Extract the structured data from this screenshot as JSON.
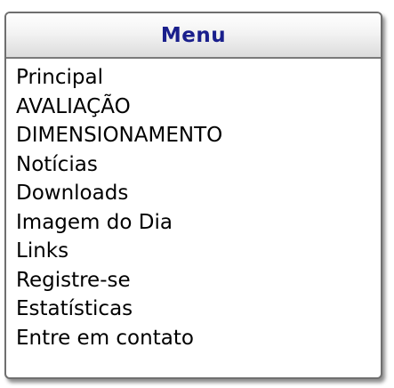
{
  "menu": {
    "title": "Menu",
    "items": [
      {
        "label": "Principal"
      },
      {
        "label": "AVALIAÇÃO"
      },
      {
        "label": "DIMENSIONAMENTO"
      },
      {
        "label": "Notícias"
      },
      {
        "label": "Downloads"
      },
      {
        "label": "Imagem do Dia"
      },
      {
        "label": "Links"
      },
      {
        "label": "Registre-se"
      },
      {
        "label": "Estatísticas"
      },
      {
        "label": "Entre em contato"
      }
    ]
  }
}
